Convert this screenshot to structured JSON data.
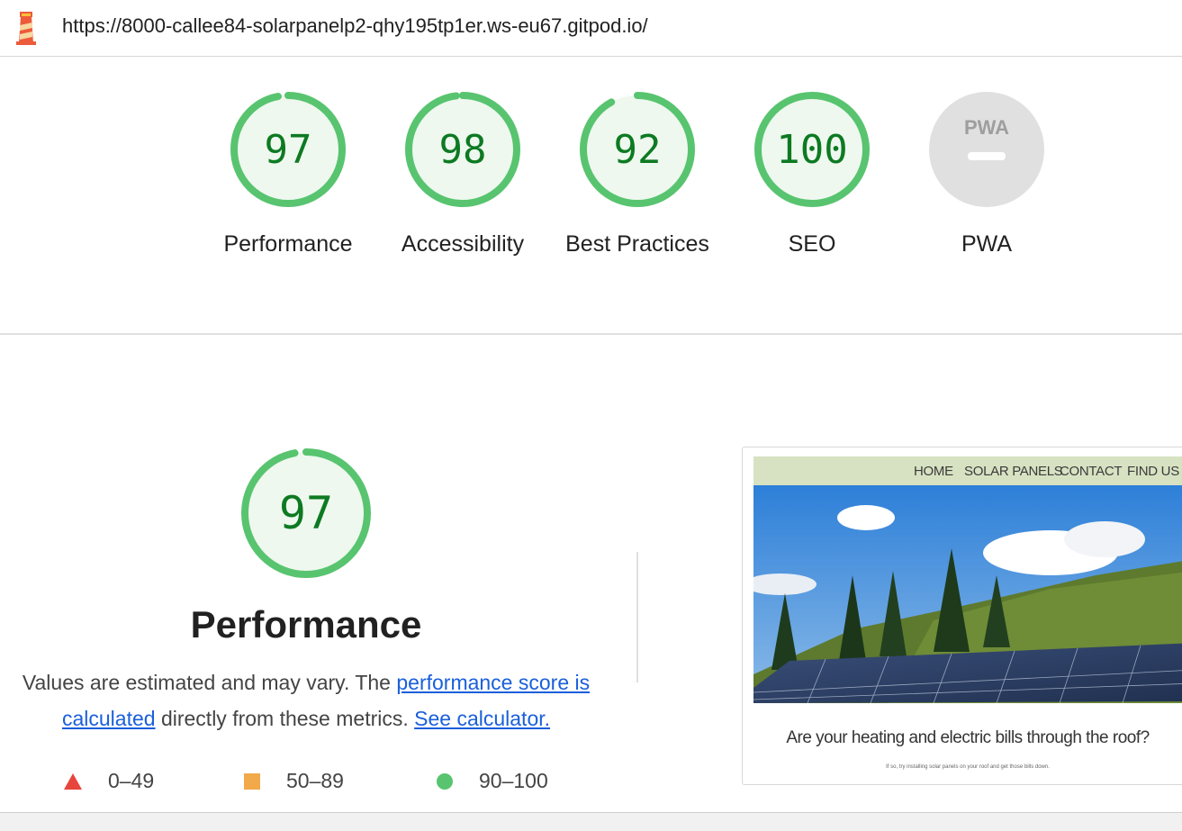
{
  "header": {
    "url": "https://8000-callee84-solarpanelp2-qhy195tp1er.ws-eu67.gitpod.io/"
  },
  "gauges": [
    {
      "score": "97",
      "label": "Performance"
    },
    {
      "score": "98",
      "label": "Accessibility"
    },
    {
      "score": "92",
      "label": "Best Practices"
    },
    {
      "score": "100",
      "label": "SEO"
    },
    {
      "score": "PWA",
      "label": "PWA"
    }
  ],
  "performance": {
    "score": "97",
    "title": "Performance",
    "desc_prefix": "Values are estimated and may vary. The ",
    "link1": "performance score is calculated",
    "desc_middle": " directly from these metrics. ",
    "link2": "See calculator."
  },
  "legend": [
    {
      "range": "0–49",
      "color": "#e8453c",
      "shape": "triangle"
    },
    {
      "range": "50–89",
      "color": "#f2a94a",
      "shape": "square"
    },
    {
      "range": "90–100",
      "color": "#58c46f",
      "shape": "circle"
    }
  ],
  "screenshot": {
    "nav": [
      "HOME",
      "SOLAR PANELS",
      "CONTACT",
      "FIND US"
    ],
    "heading": "Are your heating and electric bills through the roof?",
    "subtext": "If so, try installing solar panels on your roof and get those bills down."
  },
  "colors": {
    "pass": "#58c46f",
    "pass_bg": "#eef8ef",
    "pass_text": "#0d7a22",
    "link": "#1a5fdb"
  }
}
